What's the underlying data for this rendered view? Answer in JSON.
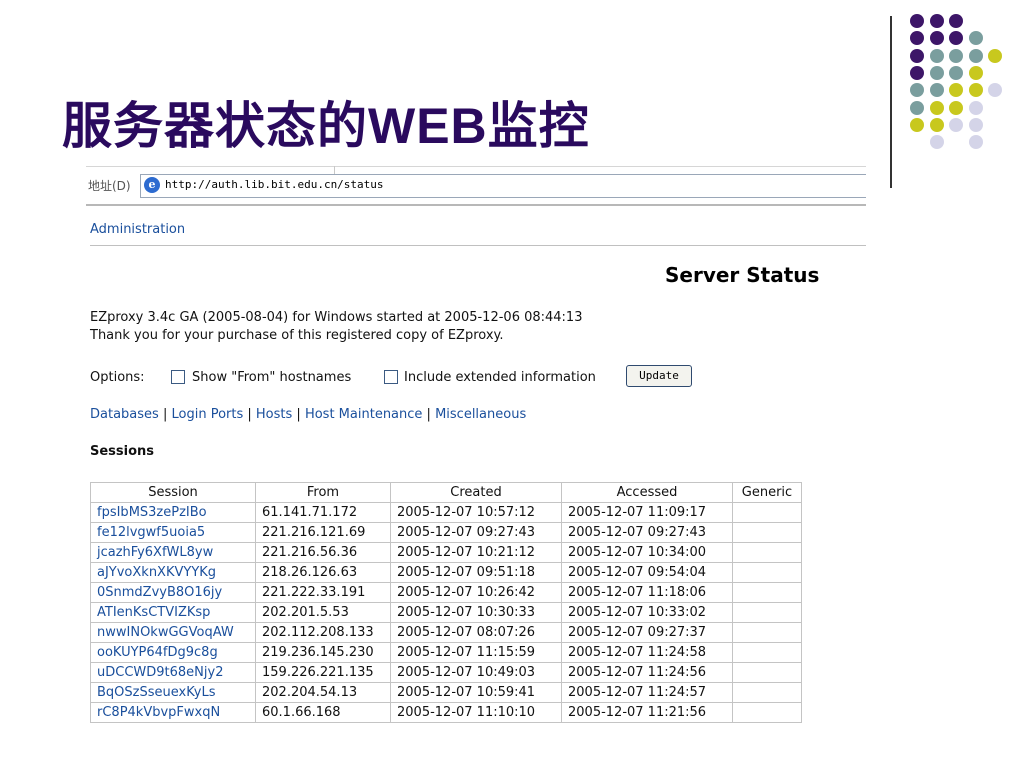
{
  "slide": {
    "title_cjk_1": "服务器状态的",
    "title_latin": "WEB",
    "title_cjk_2": "监控",
    "colors": {
      "purple": "#3d1668",
      "teal": "#7a9e9e",
      "yellow": "#c8c81e",
      "lavender": "#d4d4e8"
    }
  },
  "browser": {
    "address_label": "地址(D)",
    "url": "http://auth.lib.bit.edu.cn/status",
    "page_icon": "ie-page-icon"
  },
  "page": {
    "admin_link": "Administration",
    "heading": "Server Status",
    "info_line_1": "EZproxy 3.4c GA (2005-08-04) for Windows started at 2005-12-06 08:44:13",
    "info_line_2": "Thank you for your purchase of this registered copy of EZproxy.",
    "options": {
      "label": "Options:",
      "show_from": "Show \"From\" hostnames",
      "include_extended": "Include extended information",
      "update_button": "Update"
    },
    "nav": {
      "databases": "Databases",
      "login_ports": "Login Ports",
      "hosts": "Hosts",
      "host_maintenance": "Host Maintenance",
      "miscellaneous": "Miscellaneous",
      "separator": "|"
    },
    "sessions_heading": "Sessions",
    "table": {
      "headers": [
        "Session",
        "From",
        "Created",
        "Accessed",
        "Generic"
      ],
      "rows": [
        [
          "fpsIbMS3zePzIBo",
          "61.141.71.172",
          "2005-12-07 10:57:12",
          "2005-12-07 11:09:17",
          ""
        ],
        [
          "fe12lvgwf5uoia5",
          "221.216.121.69",
          "2005-12-07 09:27:43",
          "2005-12-07 09:27:43",
          ""
        ],
        [
          "jcazhFy6XfWL8yw",
          "221.216.56.36",
          "2005-12-07 10:21:12",
          "2005-12-07 10:34:00",
          ""
        ],
        [
          "aJYvoXknXKVYYKg",
          "218.26.126.63",
          "2005-12-07 09:51:18",
          "2005-12-07 09:54:04",
          ""
        ],
        [
          "0SnmdZvyB8O16jy",
          "221.222.33.191",
          "2005-12-07 10:26:42",
          "2005-12-07 11:18:06",
          ""
        ],
        [
          "ATIenKsCTVIZKsp",
          "202.201.5.53",
          "2005-12-07 10:30:33",
          "2005-12-07 10:33:02",
          ""
        ],
        [
          "nwwINOkwGGVoqAW",
          "202.112.208.133",
          "2005-12-07 08:07:26",
          "2005-12-07 09:27:37",
          ""
        ],
        [
          "ooKUYP64fDg9c8g",
          "219.236.145.230",
          "2005-12-07 11:15:59",
          "2005-12-07 11:24:58",
          ""
        ],
        [
          "uDCCWD9t68eNjy2",
          "159.226.221.135",
          "2005-12-07 10:49:03",
          "2005-12-07 11:24:56",
          ""
        ],
        [
          "BqOSzSseuexKyLs",
          "202.204.54.13",
          "2005-12-07 10:59:41",
          "2005-12-07 11:24:57",
          ""
        ],
        [
          "rC8P4kVbvpFwxqN",
          "60.1.66.168",
          "2005-12-07 11:10:10",
          "2005-12-07 11:21:56",
          ""
        ]
      ]
    }
  }
}
